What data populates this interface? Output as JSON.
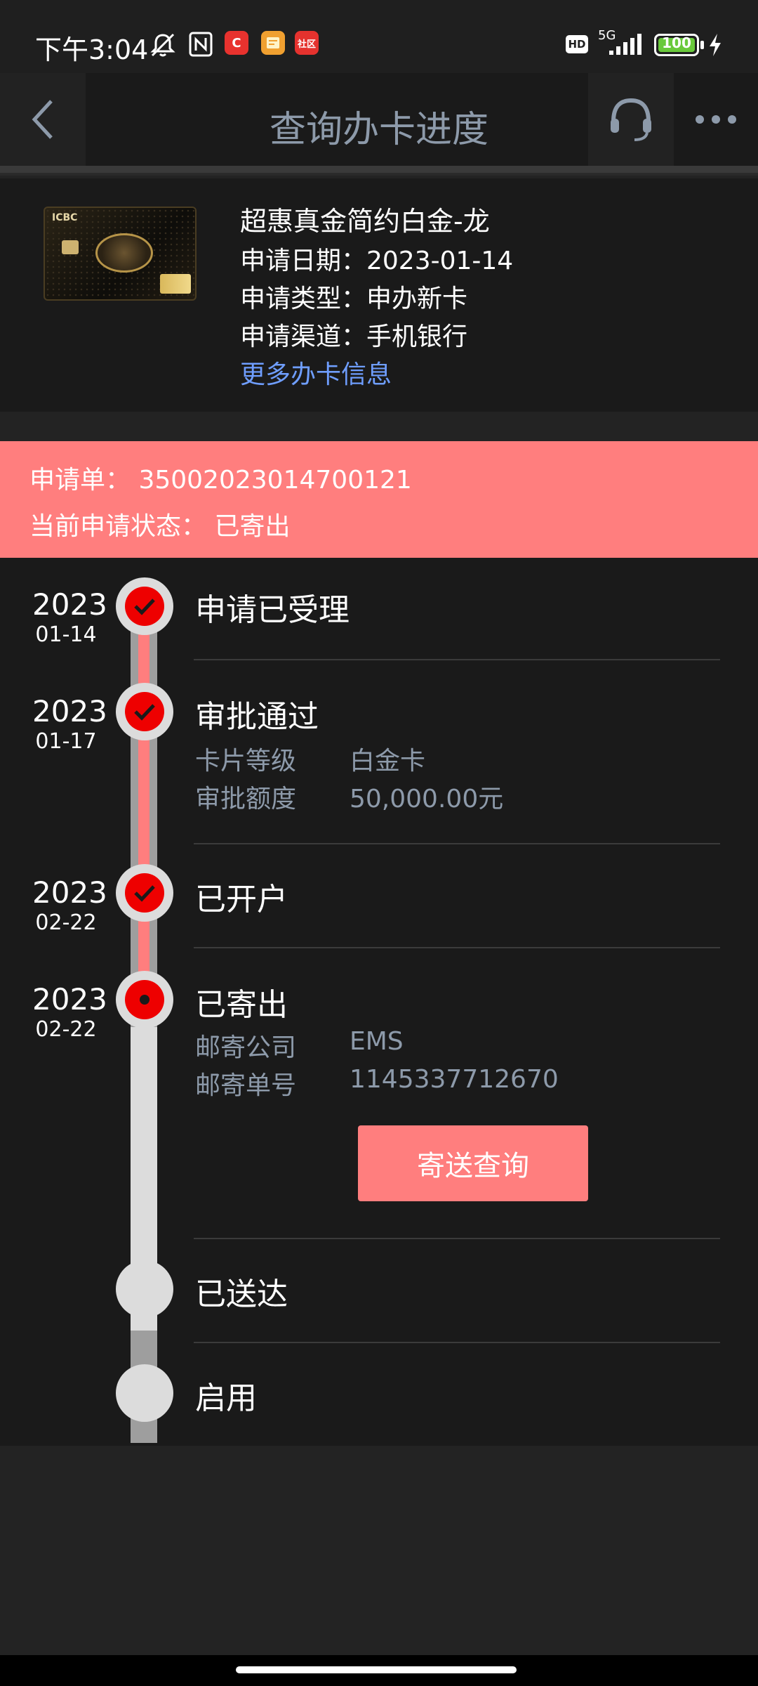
{
  "status_bar": {
    "time": "下午3:04",
    "network": "5G",
    "battery": "100",
    "battery_level": 100,
    "icons": [
      "mute-icon",
      "nfc-icon",
      "app-c-icon",
      "app-yellow-icon",
      "app-community-icon",
      "hd-icon",
      "signal-icon",
      "battery-icon",
      "charging-icon"
    ],
    "app_c_label": "C",
    "app_community_label": "社区",
    "hd_label": "HD"
  },
  "header": {
    "title": "查询办卡进度",
    "back_icon": "chevron-left-icon",
    "service_icon": "headset-icon",
    "more_icon": "more-dots-icon"
  },
  "card": {
    "name": "超惠真金简约白金-龙",
    "apply_date": "申请日期：2023-01-14",
    "apply_type": "申请类型：申办新卡",
    "apply_channel": "申请渠道：手机银行",
    "more_info": "更多办卡信息",
    "card_brand": "ICBC"
  },
  "banner": {
    "application": "申请单：  35002023014700121",
    "current_status": "当前申请状态：  已寄出",
    "color": "#ff7e7e"
  },
  "timeline": {
    "steps": [
      {
        "year": "2023",
        "date": "01-14",
        "title": "申请已受理",
        "state": "done"
      },
      {
        "year": "2023",
        "date": "01-17",
        "title": "审批通过",
        "state": "done",
        "details": [
          {
            "key": "卡片等级",
            "value": "白金卡"
          },
          {
            "key": "审批额度",
            "value": "50,000.00元"
          }
        ]
      },
      {
        "year": "2023",
        "date": "02-22",
        "title": "已开户",
        "state": "done"
      },
      {
        "year": "2023",
        "date": "02-22",
        "title": "已寄出",
        "state": "current",
        "details": [
          {
            "key": "邮寄公司",
            "value": "EMS"
          },
          {
            "key": "邮寄单号",
            "value": "1145337712670"
          }
        ]
      },
      {
        "title": "已送达",
        "state": "pending"
      },
      {
        "title": "启用",
        "state": "pending"
      }
    ],
    "track_button": "寄送查询",
    "accent_color": "#ee0000"
  }
}
